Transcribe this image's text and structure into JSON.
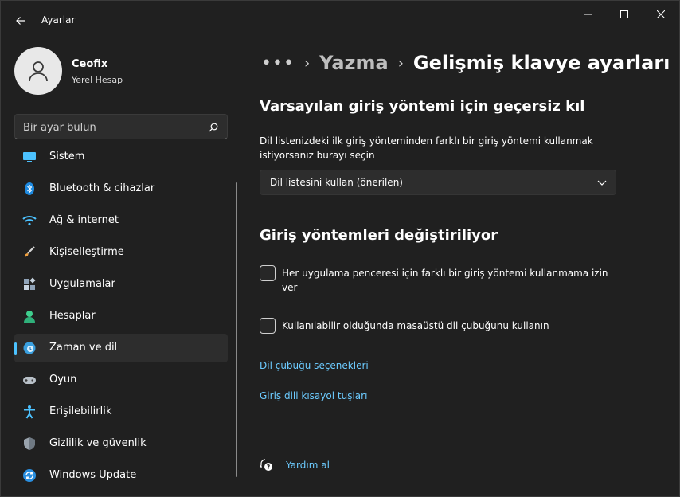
{
  "window": {
    "title": "Ayarlar",
    "controls": {
      "minimize": "minimize",
      "maximize": "maximize",
      "close": "close"
    }
  },
  "profile": {
    "name": "Ceofix",
    "account_type": "Yerel Hesap"
  },
  "search": {
    "placeholder": "Bir ayar bulun"
  },
  "sidebar": {
    "items": [
      {
        "label": "Sistem",
        "icon": "system-icon"
      },
      {
        "label": "Bluetooth & cihazlar",
        "icon": "bluetooth-icon"
      },
      {
        "label": "Ağ & internet",
        "icon": "wifi-icon"
      },
      {
        "label": "Kişiselleştirme",
        "icon": "brush-icon"
      },
      {
        "label": "Uygulamalar",
        "icon": "apps-icon"
      },
      {
        "label": "Hesaplar",
        "icon": "account-icon"
      },
      {
        "label": "Zaman ve dil",
        "icon": "time-language-icon",
        "selected": true
      },
      {
        "label": "Oyun",
        "icon": "gamepad-icon"
      },
      {
        "label": "Erişilebilirlik",
        "icon": "accessibility-icon"
      },
      {
        "label": "Gizlilik ve güvenlik",
        "icon": "shield-icon"
      },
      {
        "label": "Windows Update",
        "icon": "windows-update-icon"
      }
    ]
  },
  "breadcrumb": {
    "more": "•••",
    "parent": "Yazma",
    "current": "Gelişmiş klavye ayarları"
  },
  "override_section": {
    "heading": "Varsayılan giriş yöntemi için geçersiz kıl",
    "description": "Dil listenizdeki ilk giriş yönteminden farklı bir giriş yöntemi kullanmak istiyorsanız burayı seçin",
    "dropdown_value": "Dil listesini kullan (önerilen)"
  },
  "switching_section": {
    "heading": "Giriş yöntemleri değiştiriliyor",
    "checkboxes": [
      {
        "label": "Her uygulama penceresi için farklı bir giriş yöntemi kullanmama izin ver",
        "checked": false
      },
      {
        "label": "Kullanılabilir olduğunda masaüstü dil çubuğunu kullanın",
        "checked": false
      }
    ],
    "links": [
      "Dil çubuğu seçenekleri",
      "Giriş dili kısayol tuşları"
    ]
  },
  "help": {
    "label": "Yardım al"
  },
  "colors": {
    "background": "#202020",
    "accent": "#4cc2ff",
    "link": "#6ccbff",
    "card": "#2d2d2d"
  }
}
